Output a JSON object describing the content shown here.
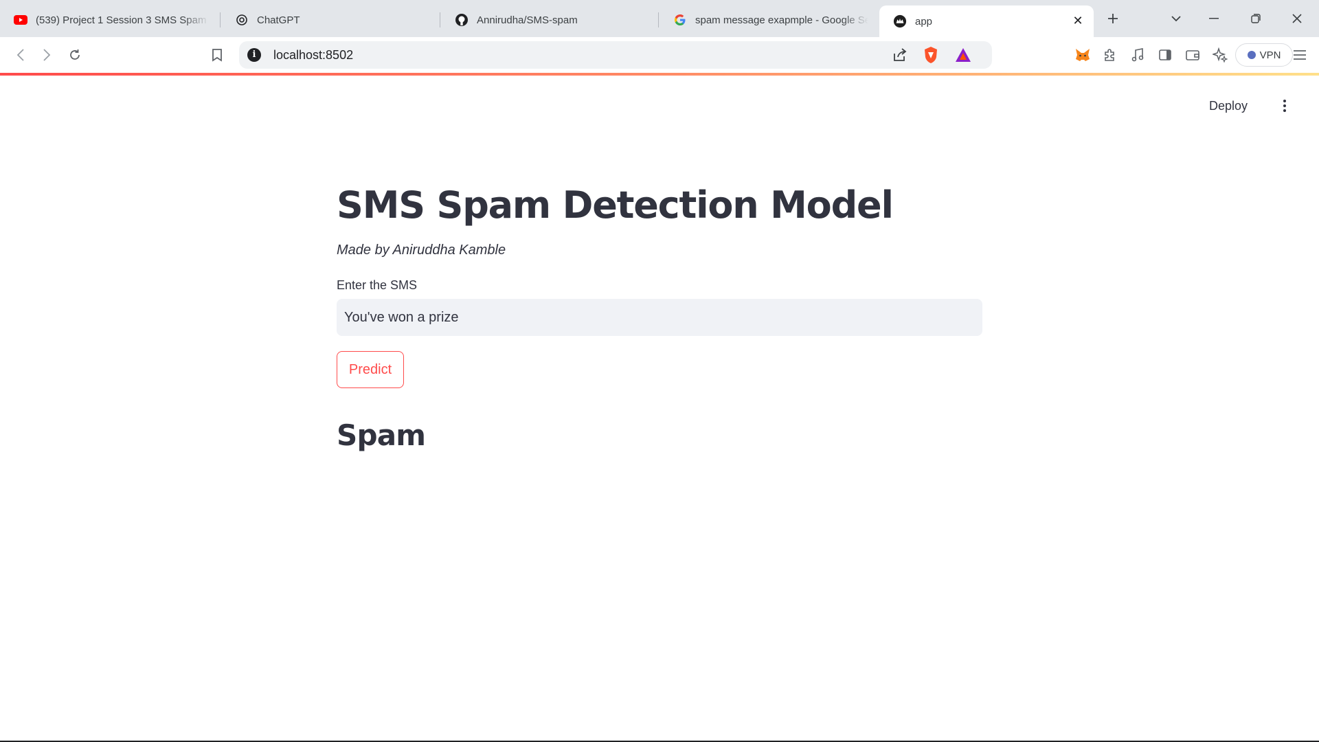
{
  "tabs": [
    {
      "title": "(539) Project 1 Session 3 SMS Spam De",
      "icon": "youtube-icon"
    },
    {
      "title": "ChatGPT",
      "icon": "chatgpt-icon"
    },
    {
      "title": "Annirudha/SMS-spam",
      "icon": "github-icon"
    },
    {
      "title": "spam message exapmple - Google Sea",
      "icon": "google-icon"
    },
    {
      "title": "app",
      "icon": "streamlit-icon",
      "active": true
    }
  ],
  "address_bar": {
    "url": "localhost:8502"
  },
  "toolbar": {
    "vpn_label": "VPN"
  },
  "app_header": {
    "deploy_label": "Deploy"
  },
  "main": {
    "title": "SMS Spam Detection Model",
    "caption": "Made by Aniruddha Kamble",
    "input_label": "Enter the SMS",
    "input_value": "You've won a prize",
    "predict_label": "Predict",
    "result": "Spam"
  },
  "colors": {
    "accent": "#ff4b4b",
    "text": "#31333f",
    "input_bg": "#f0f2f6",
    "tabstrip_bg": "#e3e6ea"
  }
}
